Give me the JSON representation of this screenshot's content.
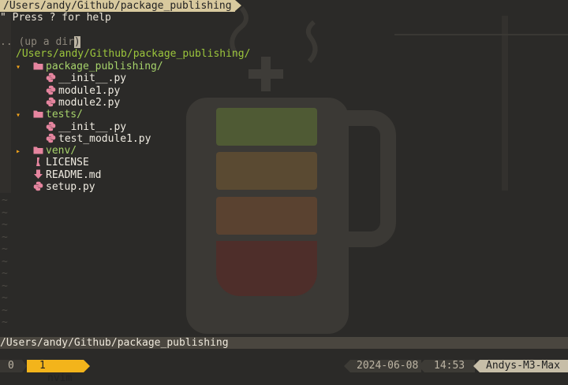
{
  "window": {
    "title_path": "/Users/andy/Github/package_publishing"
  },
  "nerdtree": {
    "help_hint": "\" Press ? for help",
    "up_dir": ".. (up a dir)",
    "root": "/Users/andy/Github/package_publishing/",
    "tree": [
      {
        "indent": 0,
        "toggle": "▾",
        "icon": "folder-icon",
        "name": "package_publishing/",
        "kind": "dir"
      },
      {
        "indent": 1,
        "toggle": "",
        "icon": "python-file-icon",
        "name": "__init__.py",
        "kind": "file"
      },
      {
        "indent": 1,
        "toggle": "",
        "icon": "python-file-icon",
        "name": "module1.py",
        "kind": "file"
      },
      {
        "indent": 1,
        "toggle": "",
        "icon": "python-file-icon",
        "name": "module2.py",
        "kind": "file"
      },
      {
        "indent": 0,
        "toggle": "▾",
        "icon": "folder-icon",
        "name": "tests/",
        "kind": "dir"
      },
      {
        "indent": 1,
        "toggle": "",
        "icon": "python-file-icon",
        "name": "__init__.py",
        "kind": "file"
      },
      {
        "indent": 1,
        "toggle": "",
        "icon": "python-file-icon",
        "name": "test_module1.py",
        "kind": "file"
      },
      {
        "indent": 0,
        "toggle": "▸",
        "icon": "folder-icon",
        "name": "venv/",
        "kind": "dir"
      },
      {
        "indent": 0,
        "toggle": "",
        "icon": "license-icon",
        "name": "LICENSE",
        "kind": "file"
      },
      {
        "indent": 0,
        "toggle": "",
        "icon": "markdown-download-icon",
        "name": "README.md",
        "kind": "file"
      },
      {
        "indent": 0,
        "toggle": "",
        "icon": "python-file-icon",
        "name": "setup.py",
        "kind": "file"
      }
    ]
  },
  "empty_line_marker": "~",
  "bottom_path": "/Users/andy/Github/package_publishing",
  "statusline": {
    "session_index": "0",
    "window_index": "1",
    "window_name": "nvim",
    "date": "2024-06-08",
    "time": "14:53",
    "host": "Andys-M3-Max"
  },
  "colors": {
    "background": "#2b2a28",
    "directory": "#a6d26a",
    "toggle_arrow": "#f3a41b",
    "active_window": "#f3b41b",
    "folder_icon": "#e6859f",
    "python_icon": "#e6859f"
  }
}
